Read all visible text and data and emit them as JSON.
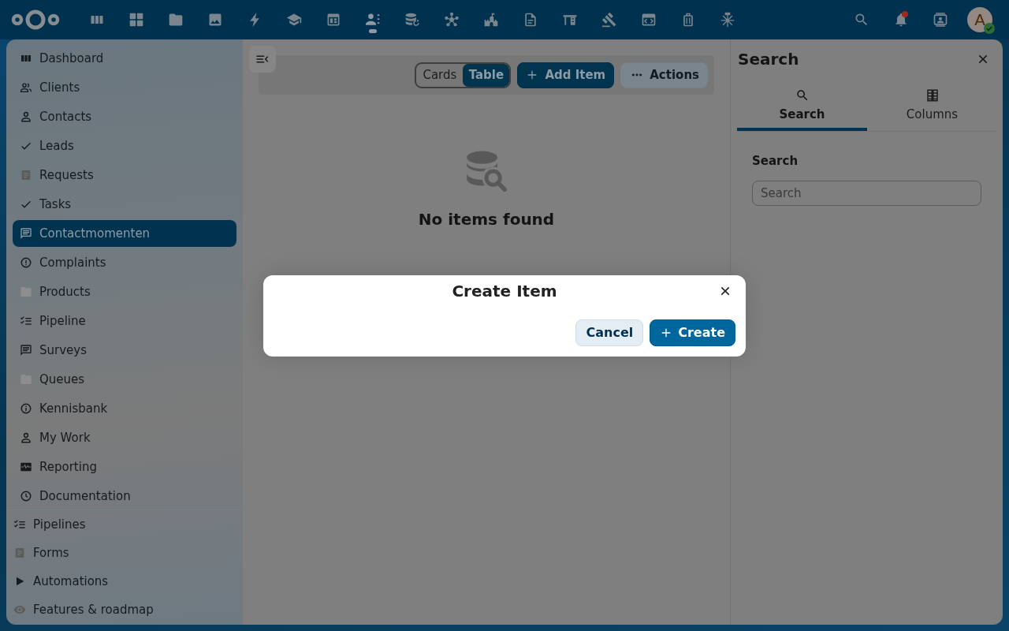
{
  "header": {
    "apps": [
      {
        "selected": false
      },
      {
        "selected": false
      },
      {
        "selected": false
      },
      {
        "selected": false
      },
      {
        "selected": false
      },
      {
        "selected": false
      },
      {
        "selected": false
      },
      {
        "selected": true
      },
      {
        "selected": false
      },
      {
        "selected": false
      },
      {
        "selected": false
      },
      {
        "selected": false
      },
      {
        "selected": false
      },
      {
        "selected": false
      },
      {
        "selected": false
      },
      {
        "selected": false
      },
      {
        "selected": false
      }
    ],
    "notifications": {
      "unread": true
    },
    "avatar": {
      "initial": "A",
      "online": true
    }
  },
  "sidebar": {
    "items": [
      {
        "label": "Dashboard",
        "selected": false
      },
      {
        "label": "Clients",
        "selected": false
      },
      {
        "label": "Contacts",
        "selected": false
      },
      {
        "label": "Leads",
        "selected": false
      },
      {
        "label": "Requests",
        "selected": false
      },
      {
        "label": "Tasks",
        "selected": false
      },
      {
        "label": "Contactmomenten",
        "selected": true
      },
      {
        "label": "Complaints",
        "selected": false
      },
      {
        "label": "Products",
        "selected": false
      },
      {
        "label": "Pipeline",
        "selected": false
      },
      {
        "label": "Surveys",
        "selected": false
      },
      {
        "label": "Queues",
        "selected": false
      },
      {
        "label": "Kennisbank",
        "selected": false
      },
      {
        "label": "My Work",
        "selected": false
      },
      {
        "label": "Reporting",
        "selected": false
      },
      {
        "label": "Documentation",
        "selected": false
      }
    ],
    "footer_items": [
      {
        "label": "Pipelines"
      },
      {
        "label": "Forms"
      },
      {
        "label": "Automations"
      },
      {
        "label": "Features & roadmap"
      }
    ]
  },
  "toolbar": {
    "views": [
      {
        "label": "Cards",
        "selected": false
      },
      {
        "label": "Table",
        "selected": true
      }
    ],
    "add_button": "Add Item",
    "actions_button": "Actions"
  },
  "empty_state": {
    "message": "No items found"
  },
  "search_panel": {
    "title": "Search",
    "tabs": [
      {
        "label": "Search",
        "selected": true
      },
      {
        "label": "Columns",
        "selected": false
      }
    ],
    "field_label": "Search",
    "field": {
      "placeholder": "Search"
    }
  },
  "dialog": {
    "title": "Create Item",
    "buttons": [
      {
        "label": "Cancel",
        "kind": "secondary"
      },
      {
        "label": "Create",
        "kind": "primary"
      }
    ]
  }
}
